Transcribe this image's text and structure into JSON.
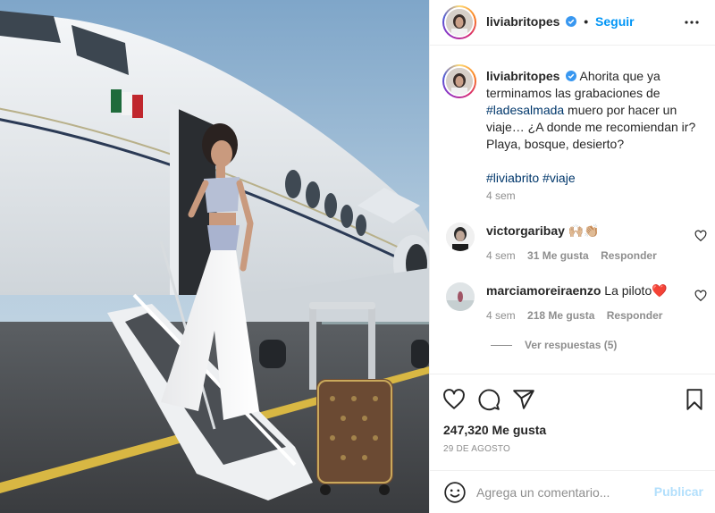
{
  "post": {
    "username": "liviabritopes",
    "follow_label": "Seguir",
    "separator": "•",
    "caption": {
      "username": "liviabritopes",
      "text_before": "Ahorita que ya terminamos las grabaciones de ",
      "hashtag_1": "#ladesalmada",
      "text_after": " muero por hacer un viaje… ¿A donde me recomiendan ir? Playa, bosque, desierto?",
      "hashtag_2": "#liviabrito",
      "hashtag_3": "#viaje",
      "time": "4 sem"
    },
    "comments": [
      {
        "username": "victorgaribay",
        "text": "🙌🏼👏🏼",
        "time": "4 sem",
        "likes": "31 Me gusta",
        "reply_label": "Responder"
      },
      {
        "username": "marciamoreiraenzo",
        "text": "La piloto❤️",
        "time": "4 sem",
        "likes": "218 Me gusta",
        "reply_label": "Responder"
      }
    ],
    "view_replies": "Ver respuestas (5)",
    "likes_count": "247,320 Me gusta",
    "date": "29 DE AGOSTO",
    "comment_placeholder": "Agrega un comentario...",
    "publish_label": "Publicar"
  },
  "icons": {
    "verified": "verified-badge-icon",
    "more": "more-options-icon",
    "like": "heart-icon",
    "comment": "comment-icon",
    "share": "share-icon",
    "save": "bookmark-icon",
    "emoji": "emoji-icon"
  },
  "colors": {
    "accent": "#0095f6",
    "hashtag": "#00376b",
    "muted": "#8e8e8e",
    "publish_disabled": "#b2dffc"
  }
}
